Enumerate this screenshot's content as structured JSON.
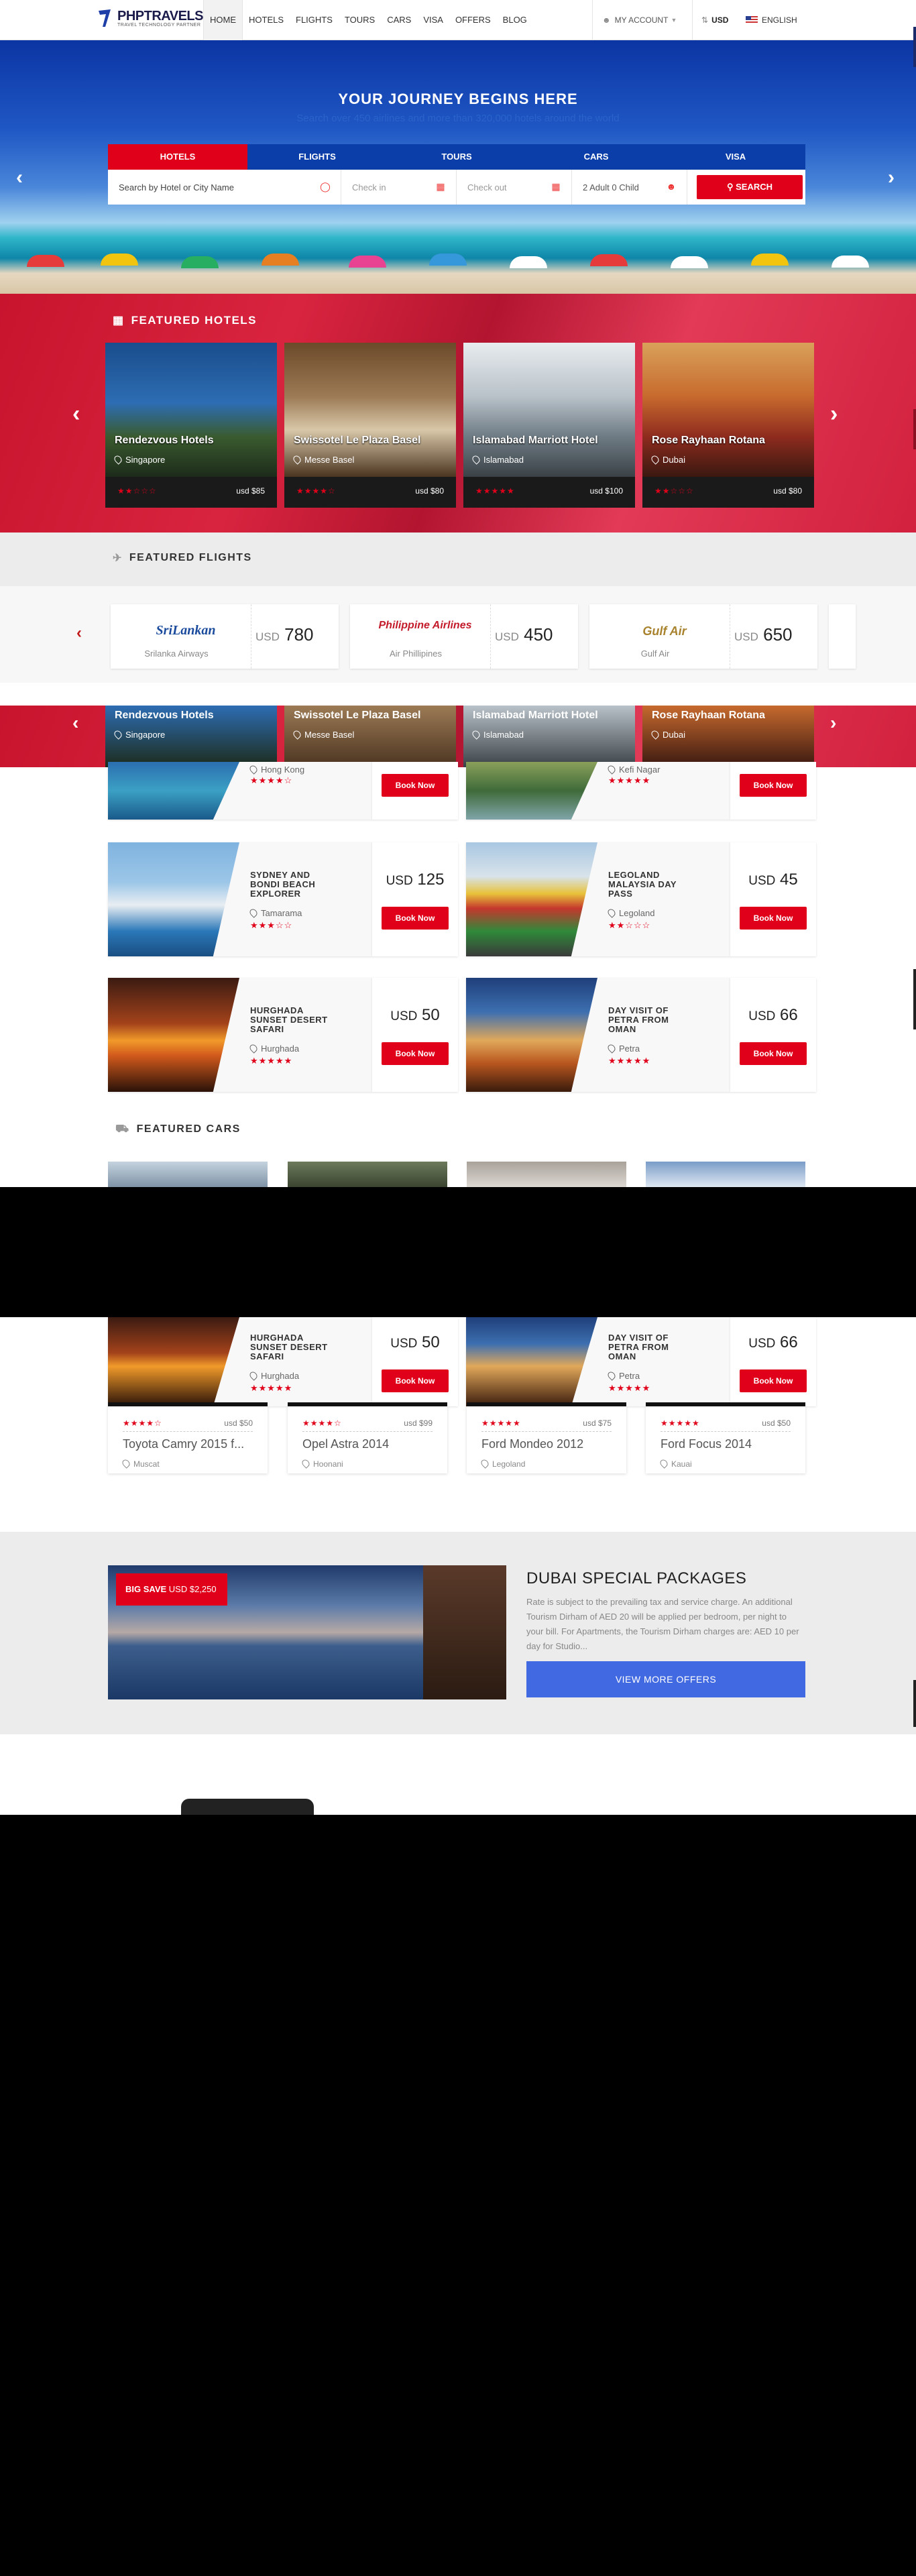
{
  "header": {
    "logo_text": "PHPTRAVELS",
    "logo_sub": "TRAVEL TECHNOLOGY PARTNER",
    "nav": [
      {
        "label": "Home"
      },
      {
        "label": "Hotels"
      },
      {
        "label": "Flights"
      },
      {
        "label": "Tours"
      },
      {
        "label": "Cars"
      },
      {
        "label": "Visa"
      },
      {
        "label": "Offers"
      },
      {
        "label": "Blog"
      }
    ],
    "account_label": "MY ACCOUNT",
    "currency": "USD",
    "language": "ENGLISH"
  },
  "hero": {
    "title": "YOUR JOURNEY BEGINS HERE",
    "subtitle": "Search over 450 airlines and more than 320,000 hotels around the world",
    "tabs": [
      "HOTELS",
      "FLIGHTS",
      "TOURS",
      "CARS",
      "VISA"
    ],
    "active_tab": "HOTELS",
    "search_placeholder": "Search by Hotel or City Name",
    "checkin_placeholder": "Check in",
    "checkout_placeholder": "Check out",
    "guests": "2 Adult 0 Child",
    "search_button": "SEARCH"
  },
  "featured_hotels": {
    "title": "FEATURED HOTELS",
    "items": [
      {
        "name": "Rendezvous Hotels",
        "location": "Singapore",
        "stars": "★★☆☆☆",
        "price": "usd $85"
      },
      {
        "name": "Swissotel Le Plaza Basel",
        "location": "Messe Basel",
        "stars": "★★★★☆",
        "price": "usd $80"
      },
      {
        "name": "Islamabad Marriott Hotel",
        "location": "Islamabad",
        "stars": "★★★★★",
        "price": "usd $100"
      },
      {
        "name": "Rose Rayhaan Rotana",
        "location": "Dubai",
        "stars": "★★☆☆☆",
        "price": "usd $80"
      }
    ]
  },
  "featured_flights": {
    "title": "FEATURED FLIGHTS",
    "items": [
      {
        "logo": "SriLankan",
        "name": "Srilanka Airways",
        "currency": "USD",
        "price": "780"
      },
      {
        "logo": "Philippine Airlines",
        "name": "Air Phillipines",
        "currency": "USD",
        "price": "450"
      },
      {
        "logo": "Gulf Air",
        "name": "Gulf Air",
        "currency": "USD",
        "price": "650"
      }
    ]
  },
  "tours": {
    "partial": [
      {
        "location": "Hong Kong",
        "stars": "★★★★☆",
        "button": "Book Now"
      },
      {
        "location": "Kefi Nagar",
        "stars": "★★★★★",
        "button": "Book Now"
      }
    ],
    "items": [
      {
        "name": "SYDNEY AND BONDI BEACH EXPLORER",
        "location": "Tamarama",
        "stars": "★★★☆☆",
        "currency": "USD",
        "price": "125",
        "button": "Book Now"
      },
      {
        "name": "LEGOLAND MALAYSIA DAY PASS",
        "location": "Legoland",
        "stars": "★★☆☆☆",
        "currency": "USD",
        "price": "45",
        "button": "Book Now"
      },
      {
        "name": "HURGHADA SUNSET DESERT SAFARI",
        "location": "Hurghada",
        "stars": "★★★★★",
        "currency": "USD",
        "price": "50",
        "button": "Book Now"
      },
      {
        "name": "DAY VISIT OF PETRA FROM OMAN",
        "location": "Petra",
        "stars": "★★★★★",
        "currency": "USD",
        "price": "66",
        "button": "Book Now"
      }
    ]
  },
  "featured_cars": {
    "title": "FEATURED CARS",
    "items": [
      {
        "name": "Toyota Camry 2015 f...",
        "location": "Muscat",
        "stars": "★★★★☆",
        "price": "usd $50"
      },
      {
        "name": "Opel Astra 2014",
        "location": "Hoonani",
        "stars": "★★★★☆",
        "price": "usd $99"
      },
      {
        "name": "Ford Mondeo 2012",
        "location": "Legoland",
        "stars": "★★★★★",
        "price": "usd $75"
      },
      {
        "name": "Ford Focus 2014",
        "location": "Kauai",
        "stars": "★★★★★",
        "price": "usd $50"
      }
    ]
  },
  "offers": {
    "badge_label": "BIG SAVE",
    "badge_price": "USD $2,250",
    "title": "DUBAI SPECIAL PACKAGES",
    "text": "Rate is subject to the prevailing tax and service charge. An additional Tourism Dirham of AED 20 will be applied per bedroom, per night to your bill. For Apartments, the Tourism Dirham charges are: AED 10 per day for Studio...",
    "button": "VIEW MORE OFFERS"
  },
  "colors": {
    "brand_red": "#e0001a",
    "brand_blue": "#0b3ea8",
    "offer_blue": "#4169e1"
  }
}
